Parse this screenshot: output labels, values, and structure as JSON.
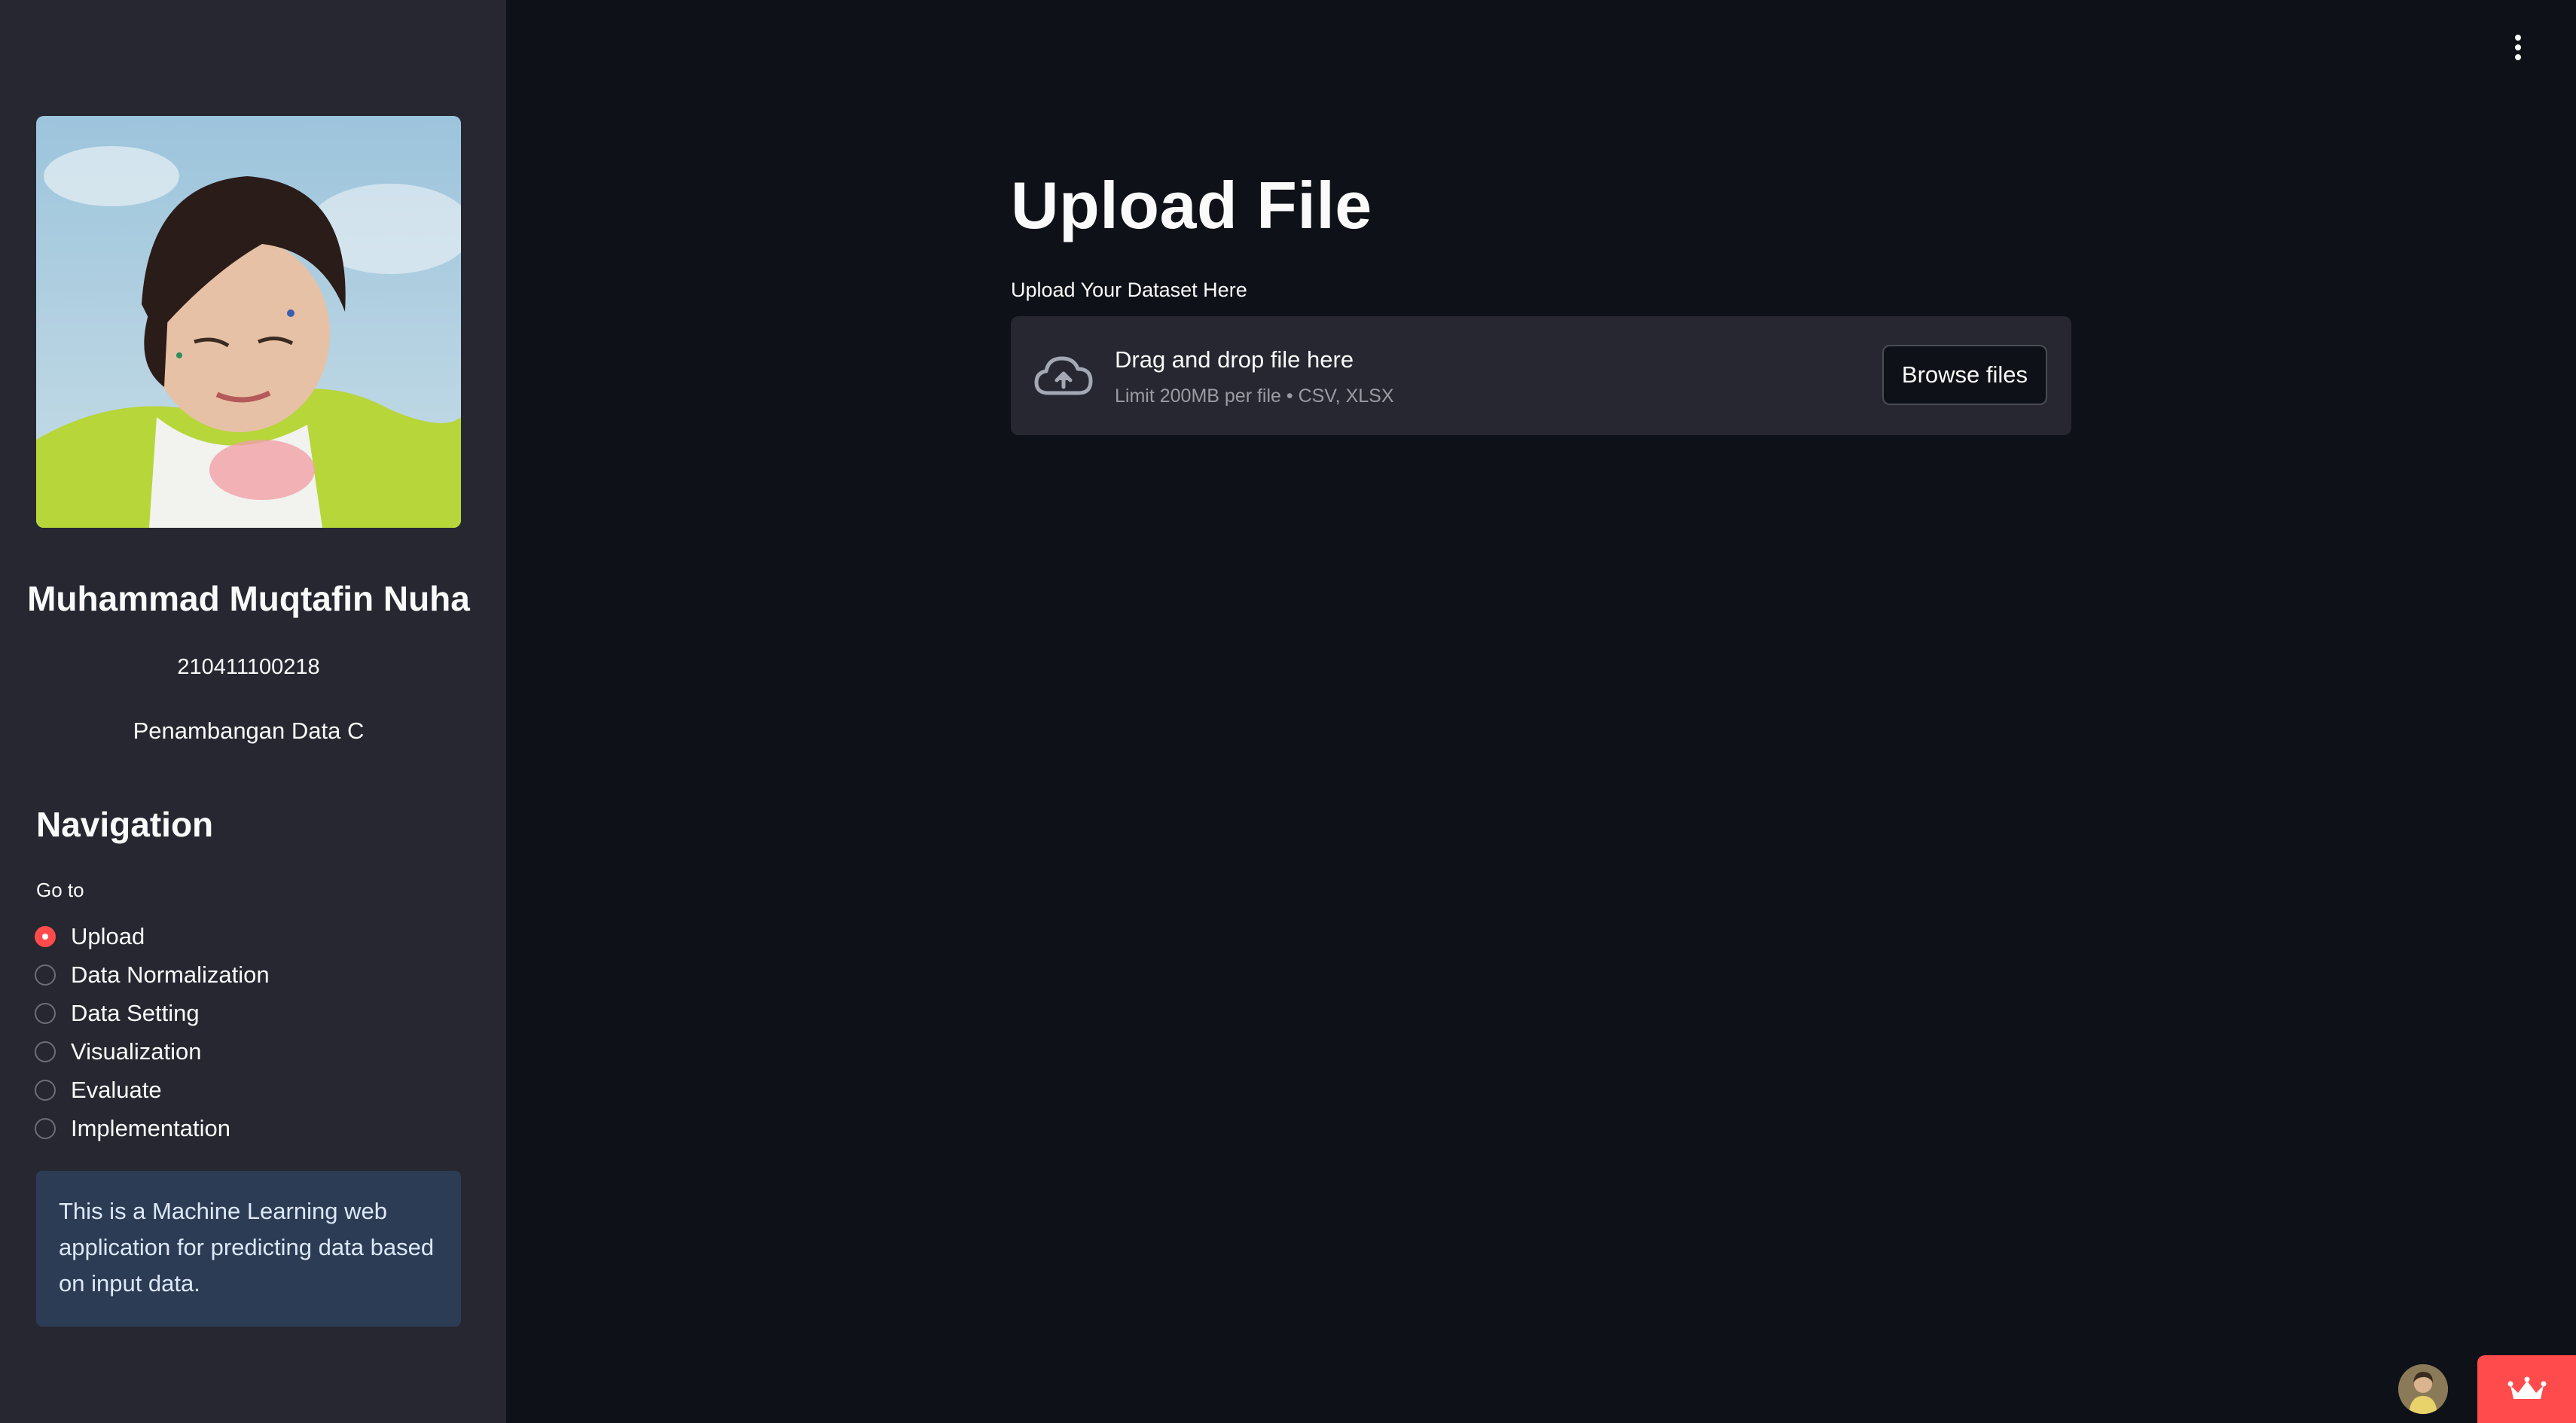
{
  "sidebar": {
    "profile": {
      "name": "Muhammad Muqtafin Nuha",
      "student_id": "210411100218",
      "class_name": "Penambangan Data C"
    },
    "nav_title": "Navigation",
    "nav_label": "Go to",
    "nav_options": [
      {
        "label": "Upload",
        "selected": true
      },
      {
        "label": "Data Normalization",
        "selected": false
      },
      {
        "label": "Data Setting",
        "selected": false
      },
      {
        "label": "Visualization",
        "selected": false
      },
      {
        "label": "Evaluate",
        "selected": false
      },
      {
        "label": "Implementation",
        "selected": false
      }
    ],
    "info_text": "This is a Machine Learning web application for predicting data based on input data."
  },
  "main": {
    "title": "Upload File",
    "uploader": {
      "label": "Upload Your Dataset Here",
      "drop_title": "Drag and drop file here",
      "drop_subtitle": "Limit 200MB per file • CSV, XLSX",
      "button_label": "Browse files"
    }
  },
  "icons": {
    "menu": "vertical-dots-icon",
    "upload": "cloud-upload-icon",
    "deploy": "crown-icon"
  },
  "colors": {
    "accent": "#ff4b4b",
    "background": "#0e1117",
    "sidebar": "#262730",
    "info_box": "#2d3c55"
  }
}
